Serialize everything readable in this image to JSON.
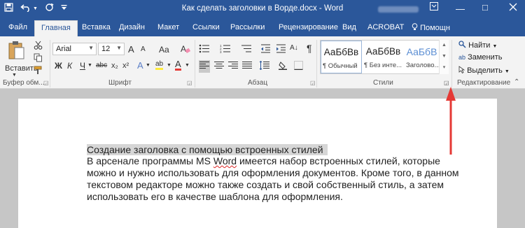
{
  "window": {
    "title": "Как сделать заголовки в Ворде.docx - Word",
    "controls": {
      "minimize": "—",
      "maximize": "□",
      "ribbon_options": "⊡"
    }
  },
  "quick_access": {
    "save_icon": "save-icon",
    "undo_icon": "undo-icon",
    "redo_icon": "redo-icon",
    "customize_icon": "customize-qat-icon"
  },
  "tabs": [
    "Файл",
    "Главная",
    "Вставка",
    "Дизайн",
    "Макет",
    "Ссылки",
    "Рассылки",
    "Рецензирование",
    "Вид",
    "ACROBAT",
    "Помощн"
  ],
  "active_tab": "Главная",
  "ribbon": {
    "clipboard": {
      "paste_label": "Вставить",
      "group_label": "Буфер обм..."
    },
    "font": {
      "font_name": "Arial",
      "font_size": "12",
      "group_label": "Шрифт",
      "buttons": [
        "A",
        "A",
        "Aa",
        "Ж",
        "К",
        "Ч",
        "abc",
        "x₂",
        "x²",
        "A",
        "ab",
        "A"
      ]
    },
    "paragraph": {
      "group_label": "Абзац",
      "sort_glyph": "A↓",
      "pilcrow": "¶"
    },
    "styles": {
      "group_label": "Стили",
      "items": [
        {
          "preview": "АаБбВв",
          "name": "¶ Обычный"
        },
        {
          "preview": "АаБбВв",
          "name": "¶ Без инте..."
        },
        {
          "preview": "АаБбВ",
          "name": "Заголово..."
        }
      ]
    },
    "editing": {
      "group_label": "Редактирование",
      "find": "Найти",
      "replace": "Заменить",
      "select": "Выделить"
    }
  },
  "document": {
    "heading": "Создание заголовка с помощью встроенных стилей",
    "lines": [
      {
        "before": "В арсенале программы MS ",
        "underlined": "Word",
        "after": " имеется набор встроенных стилей, которые"
      },
      {
        "text": "можно и нужно использовать для оформления документов. Кроме того, в данном"
      },
      {
        "text": "текстовом редакторе можно также создать и свой собственный стиль, а затем"
      },
      {
        "text": "использовать его в качестве шаблона для оформления."
      }
    ]
  },
  "colors": {
    "brand": "#2b579a",
    "ribbon": "#f3f3f3",
    "arrow": "#e53935"
  }
}
